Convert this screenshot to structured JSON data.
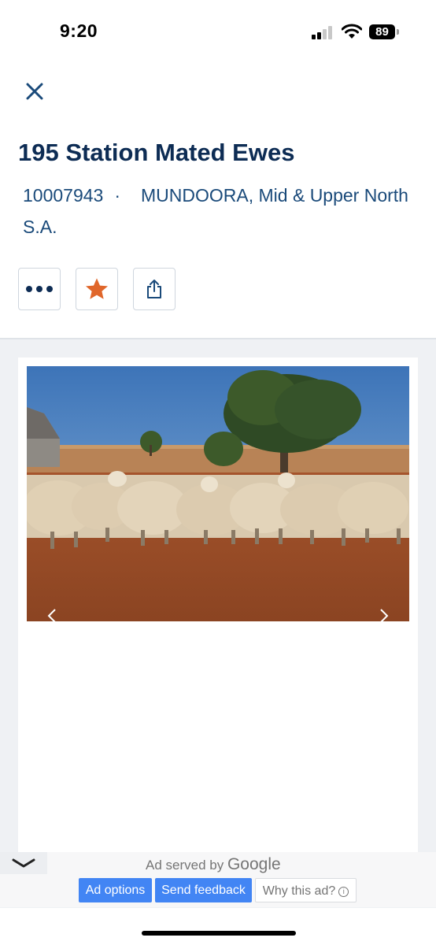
{
  "status_bar": {
    "time": "9:20",
    "battery_level": "89"
  },
  "header": {
    "close_icon": "close-icon"
  },
  "listing": {
    "title": "195 Station Mated Ewes",
    "id": "10007943",
    "separator": "·",
    "location": "MUNDOORA, Mid & Upper North S.A."
  },
  "actions": [
    {
      "name": "more-options",
      "icon": "ellipsis-icon"
    },
    {
      "name": "favourite",
      "icon": "star-icon"
    },
    {
      "name": "share",
      "icon": "share-icon"
    }
  ],
  "gallery": {
    "image": "sheep-flock-photo"
  },
  "ad": {
    "served_by": "Ad served by",
    "google": "Google",
    "ad_options": "Ad options",
    "send_feedback": "Send feedback",
    "why_this_ad": "Why this ad?"
  },
  "colors": {
    "title": "#0d2c54",
    "meta": "#1a4a7a",
    "star": "#e0662a",
    "ad_button": "#4285f4"
  }
}
